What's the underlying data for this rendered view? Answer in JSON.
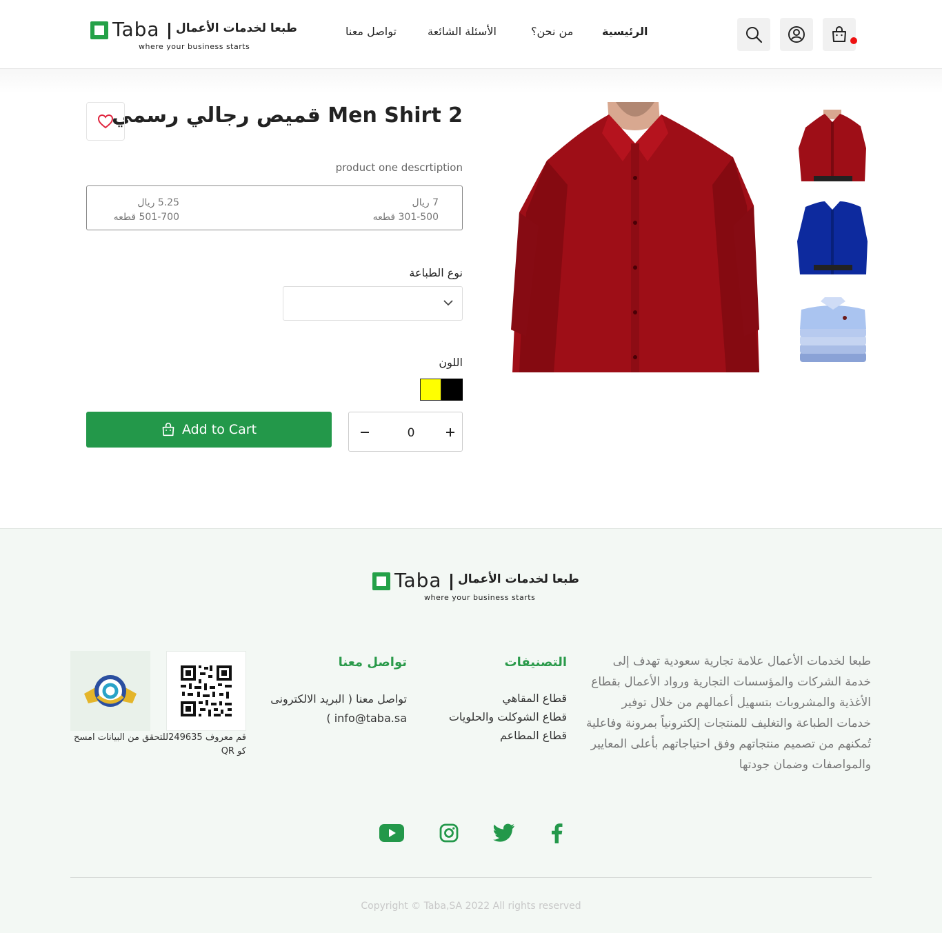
{
  "brand": {
    "name": "Taba",
    "arabic_name": "طبعا لخدمات الأعمال",
    "tagline": "where your business starts",
    "accent_color": "#23984a"
  },
  "nav": {
    "items": [
      {
        "label": "الرئيسية",
        "active": true
      },
      {
        "label": "من نحن؟",
        "active": false
      },
      {
        "label": "الأسئلة الشائعة",
        "active": false
      },
      {
        "label": "تواصل معنا",
        "active": false
      }
    ]
  },
  "header_icons": [
    "search-icon",
    "user-icon",
    "cart-icon"
  ],
  "product": {
    "title": "Men Shirt 2 قميص رجالي رسمي",
    "description": "product one descrtiption",
    "price_tiers": [
      {
        "price": "7 ريال",
        "range": "301-500 قطعه"
      },
      {
        "price": "5.25 ريال",
        "range": "501-700 قطعه"
      }
    ],
    "print_type_label": "نوع الطباعة",
    "print_type_value": "",
    "color_label": "اللون",
    "colors": [
      "#000000",
      "#ffff00"
    ],
    "add_to_cart_label": "Add to Cart",
    "quantity": "0",
    "images": [
      {
        "name": "red-shirt",
        "color": "#a0111a"
      },
      {
        "name": "blue-shirt",
        "color": "#0d2a9e"
      },
      {
        "name": "folded-shirts",
        "color": "#aac4f0"
      }
    ]
  },
  "footer": {
    "about": "طبعا لخدمات الأعمال علامة تجارية سعودية تهدف إلى خدمة الشركات والمؤسسات التجارية ورواد الأعمال بقطاع الأغذية والمشروبات بتسهيل أعمالهم من خلال توفير خدمات الطباعة والتغليف للمنتجات إلكترونياً بمرونة وفاعلية تُمكنهم من تصميم منتجاتهم وفق احتياجاتهم بأعلى المعايير والمواصفات وضمان جودتها",
    "categories_title": "التصنيفات",
    "categories": [
      "قطاع المقاهي",
      "قطاع الشوكلت والحلويات",
      "قطاع المطاعم"
    ],
    "contact_title": "تواصل معنا",
    "contact_text": "تواصل معنا ( البريد الالكترونى info@taba.sa )",
    "verify_text": "قم معروف 249635للتحقق من البيانات امسح كو QR",
    "social": [
      "facebook-icon",
      "twitter-icon",
      "instagram-icon",
      "youtube-icon"
    ],
    "copyright": "Copyright © Taba,SA 2022 All rights reserved"
  }
}
